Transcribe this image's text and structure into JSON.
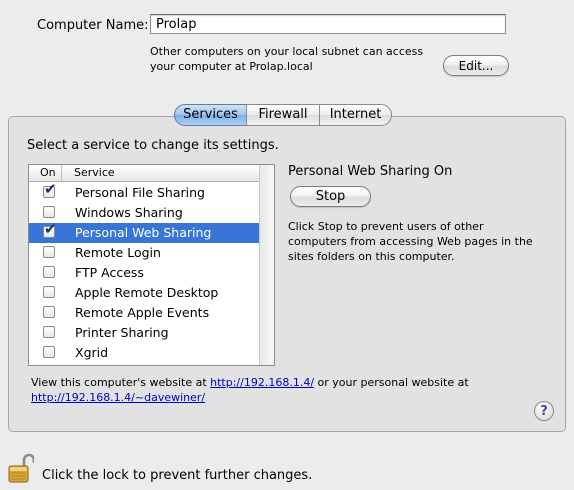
{
  "computer_name": {
    "label": "Computer Name:",
    "value": "Prolap",
    "note": "Other computers on your local subnet can access your computer at Prolap.local",
    "edit_label": "Edit..."
  },
  "tabs": [
    {
      "label": "Services",
      "active": true
    },
    {
      "label": "Firewall",
      "active": false
    },
    {
      "label": "Internet",
      "active": false
    }
  ],
  "services": {
    "instruction": "Select a service to change its settings.",
    "col_on": "On",
    "col_service": "Service",
    "items": [
      {
        "label": "Personal File Sharing",
        "checked": true,
        "selected": false
      },
      {
        "label": "Windows Sharing",
        "checked": false,
        "selected": false
      },
      {
        "label": "Personal Web Sharing",
        "checked": true,
        "selected": true
      },
      {
        "label": "Remote Login",
        "checked": false,
        "selected": false
      },
      {
        "label": "FTP Access",
        "checked": false,
        "selected": false
      },
      {
        "label": "Apple Remote Desktop",
        "checked": false,
        "selected": false
      },
      {
        "label": "Remote Apple Events",
        "checked": false,
        "selected": false
      },
      {
        "label": "Printer Sharing",
        "checked": false,
        "selected": false
      },
      {
        "label": "Xgrid",
        "checked": false,
        "selected": false
      }
    ]
  },
  "detail": {
    "status": "Personal Web Sharing On",
    "stop_label": "Stop",
    "note": "Click Stop to prevent users of other computers from accessing Web pages in the sites folders on this computer."
  },
  "website": {
    "prefix": "View this computer's website at ",
    "link1": "http://192.168.1.4/",
    "middle": " or your personal website at ",
    "link2": "http://192.168.1.4/~davewiner/"
  },
  "help_label": "?",
  "lock_note": "Click the lock to prevent further changes.",
  "colors": {
    "selection": "#3875d7",
    "link": "#0000d0",
    "accent_tab": "#7eb0e6"
  }
}
